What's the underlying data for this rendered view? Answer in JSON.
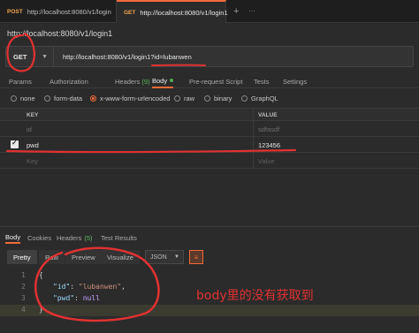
{
  "tabs": [
    {
      "method": "POST",
      "label": "http://localhost:8080/v1/login"
    },
    {
      "method": "GET",
      "label": "http://localhost:8080/v1/login1"
    }
  ],
  "tab_actions": {
    "add": "+",
    "more": "···"
  },
  "request": {
    "name": "http://localhost:8080/v1/login1",
    "method": "GET",
    "url": "http://localhost:8080/v1/login1?id=lubanwen"
  },
  "request_tabs": [
    {
      "label": "Params"
    },
    {
      "label": "Authorization"
    },
    {
      "label": "Headers",
      "count": "(9)"
    },
    {
      "label": "Body"
    },
    {
      "label": "Pre-request Script"
    },
    {
      "label": "Tests"
    },
    {
      "label": "Settings"
    }
  ],
  "body_types": [
    "none",
    "form-data",
    "x-www-form-urlencoded",
    "raw",
    "binary",
    "GraphQL"
  ],
  "body_type_selected": "x-www-form-urlencoded",
  "table": {
    "headers": {
      "key": "KEY",
      "value": "VALUE"
    },
    "rows": [
      {
        "key": "id",
        "value": "sdfasdf",
        "enabled": false
      },
      {
        "key": "pwd",
        "value": "123456",
        "enabled": true
      }
    ],
    "placeholder": {
      "key": "Key",
      "value": "Value"
    }
  },
  "response_tabs": [
    {
      "label": "Body"
    },
    {
      "label": "Cookies"
    },
    {
      "label": "Headers",
      "count": "(5)"
    },
    {
      "label": "Test Results"
    }
  ],
  "view_buttons": [
    "Pretty",
    "Raw",
    "Preview",
    "Visualize"
  ],
  "format": "JSON",
  "code": {
    "lines": [
      "1",
      "2",
      "3",
      "4"
    ],
    "open_brace": "{",
    "close_brace": "}",
    "key1": "\"id\"",
    "val1": "\"lubanwen\"",
    "key2": "\"pwd\"",
    "val2": "null",
    "colon": ": ",
    "comma": ","
  },
  "annotation": "body里的没有获取到",
  "colors": {
    "accent": "#f26b3a",
    "annotation_red": "#e23131",
    "background": "#2b2b2b"
  }
}
